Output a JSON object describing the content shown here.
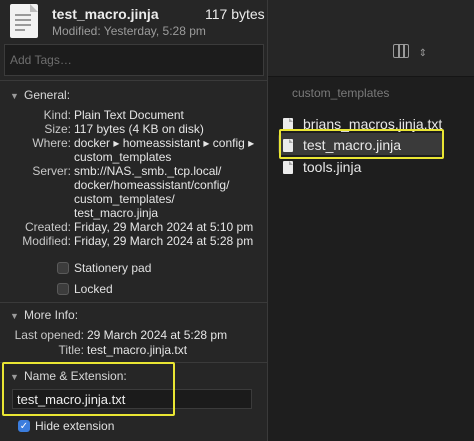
{
  "header": {
    "filename": "test_macro.jinja",
    "size": "117 bytes",
    "modified": "Modified: Yesterday, 5:28 pm"
  },
  "tags": {
    "placeholder": "Add Tags…"
  },
  "general": {
    "title": "General:",
    "rows": [
      {
        "label": "Kind:",
        "value": "Plain Text Document"
      },
      {
        "label": "Size:",
        "value": "117 bytes (4 KB on disk)"
      },
      {
        "label": "Where:",
        "value": "docker ▸ homeassistant ▸ config ▸",
        "value2": "custom_templates"
      },
      {
        "label": "Server:",
        "value": "smb://NAS._smb._tcp.local/",
        "value2": "docker/homeassistant/config/",
        "value3": "custom_templates/",
        "value4": "test_macro.jinja"
      },
      {
        "label": "Created:",
        "value": "Friday, 29 March 2024 at 5:10 pm"
      },
      {
        "label": "Modified:",
        "value": "Friday, 29 March 2024 at 5:28 pm"
      }
    ],
    "stationery_label": "Stationery pad",
    "locked_label": "Locked"
  },
  "more_info": {
    "title": "More Info:",
    "last_opened_label": "Last opened:",
    "last_opened_value": "29 March 2024 at 5:28 pm",
    "title_label": "Title:",
    "title_value": "test_macro.jinja.txt"
  },
  "name_ext": {
    "title": "Name & Extension:",
    "name_value": "test_macro.jinja.txt",
    "hide_ext_label": "Hide extension",
    "hide_ext_checked": true
  },
  "browser": {
    "folder": "custom_templates",
    "files": [
      "brians_macros.jinja.txt",
      "test_macro.jinja",
      "tools.jinja"
    ],
    "selected_file": "test_macro.jinja"
  },
  "colors": {
    "highlight": "#e9e533",
    "accent": "#3b7ddd"
  },
  "icons": {
    "view": "columns-view-icon",
    "view_chevron": "chevron-updown-icon",
    "file": "document-icon"
  }
}
